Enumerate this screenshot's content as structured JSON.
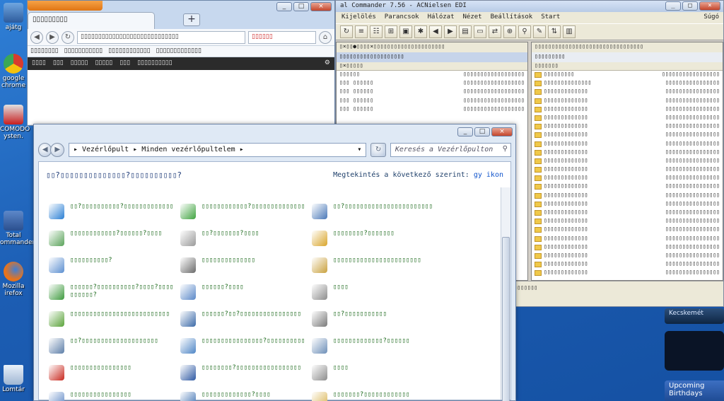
{
  "desktop": {
    "icons": [
      {
        "label": "ajátg"
      },
      {
        "label": "google chrome"
      },
      {
        "label": "COMODO ysten."
      },
      {
        "label": "Total ommander"
      },
      {
        "label": "Mozilla irefox"
      },
      {
        "label": "Lomtár"
      }
    ]
  },
  "chrome": {
    "tab_title": "▯▯▯▯▯▯▯▯▯",
    "omnibox": "▯▯▯▯▯▯▯▯▯▯▯▯▯▯▯▯▯▯▯▯▯▯▯▯▯▯▯▯",
    "search": "▯▯▯▯▯▯",
    "bookmarks": [
      "▯▯▯▯▯▯▯▯",
      "▯▯▯▯▯▯▯▯▯▯▯",
      "▯▯▯▯▯▯▯▯▯▯▯▯",
      "▯▯▯▯▯▯▯▯▯▯▯▯▯"
    ],
    "darkbar": [
      "▯▯▯▯",
      "▯▯▯",
      "▯▯▯▯▯",
      "▯▯▯▯▯",
      "▯▯▯",
      "▯▯▯▯▯▯▯▯▯▯"
    ]
  },
  "tc": {
    "title": "al Commander 7.56 - ACNielsen EDI",
    "menu": [
      "Kijelölés",
      "Parancsok",
      "Hálózat",
      "Nézet",
      "Beállítások",
      "Start"
    ],
    "help": "Súgó",
    "left_drive": "▯×▯▯●▯▯▯▯×▯▯▯▯▯▯▯▯▯▯▯▯▯▯▯▯▯▯▯▯▯",
    "left_path": "▯▯▯▯▯▯▯▯▯▯▯▯▯▯▯▯▯▯▯",
    "left_col": "▯×▯▯▯▯▯",
    "left_rows": [
      {
        "name": "▯▯▯▯▯▯",
        "size": "▯▯▯▯▯▯▯▯▯▯▯▯▯▯▯▯▯▯"
      },
      {
        "name": "▯▯▯  ▯▯▯▯▯▯",
        "size": "▯▯▯▯▯▯▯▯▯▯▯▯▯▯▯▯▯▯"
      },
      {
        "name": "▯▯▯  ▯▯▯▯▯▯",
        "size": "▯▯▯▯▯▯▯▯▯▯▯▯▯▯▯▯▯▯"
      },
      {
        "name": "▯▯▯  ▯▯▯▯▯▯",
        "size": "▯▯▯▯▯▯▯▯▯▯▯▯▯▯▯▯▯▯"
      },
      {
        "name": "▯▯▯  ▯▯▯▯▯▯",
        "size": "▯▯▯▯▯▯▯▯▯▯▯▯▯▯▯▯▯▯"
      }
    ],
    "right_drive": "▯▯▯▯▯▯▯▯▯▯▯▯▯▯▯▯▯▯▯▯▯▯▯▯▯▯▯▯▯▯▯▯",
    "right_path": "▯▯▯▯▯▯▯▯▯",
    "right_col": "▯▯▯▯▯▯▯",
    "right_rows": [
      {
        "name": "▯▯▯▯▯▯▯▯▯",
        "size": "▯▯▯▯▯▯▯▯▯▯▯▯▯▯▯▯▯"
      },
      {
        "name": "▯▯▯▯▯▯▯▯▯▯▯▯▯▯",
        "size": "▯▯▯▯▯▯▯▯▯▯▯▯▯▯▯▯"
      },
      {
        "name": "▯▯▯▯▯▯▯▯▯▯▯▯▯",
        "size": "▯▯▯▯▯▯▯▯▯▯▯▯▯▯▯▯"
      },
      {
        "name": "▯▯▯▯▯▯▯▯▯▯▯▯▯",
        "size": "▯▯▯▯▯▯▯▯▯▯▯▯▯▯▯▯"
      },
      {
        "name": "▯▯▯▯▯▯▯▯▯▯▯▯▯",
        "size": "▯▯▯▯▯▯▯▯▯▯▯▯▯▯▯▯"
      },
      {
        "name": "▯▯▯▯▯▯▯▯▯▯▯▯▯",
        "size": "▯▯▯▯▯▯▯▯▯▯▯▯▯▯▯▯"
      },
      {
        "name": "▯▯▯▯▯▯▯▯▯▯▯▯▯",
        "size": "▯▯▯▯▯▯▯▯▯▯▯▯▯▯▯▯"
      },
      {
        "name": "▯▯▯▯▯▯▯▯▯▯▯▯▯",
        "size": "▯▯▯▯▯▯▯▯▯▯▯▯▯▯▯▯"
      },
      {
        "name": "▯▯▯▯▯▯▯▯▯▯▯▯▯",
        "size": "▯▯▯▯▯▯▯▯▯▯▯▯▯▯▯▯"
      },
      {
        "name": "▯▯▯▯▯▯▯▯▯▯▯▯▯",
        "size": "▯▯▯▯▯▯▯▯▯▯▯▯▯▯▯▯"
      },
      {
        "name": "▯▯▯▯▯▯▯▯▯▯▯▯▯",
        "size": "▯▯▯▯▯▯▯▯▯▯▯▯▯▯▯▯"
      },
      {
        "name": "▯▯▯▯▯▯▯▯▯▯▯▯▯",
        "size": "▯▯▯▯▯▯▯▯▯▯▯▯▯▯▯▯"
      },
      {
        "name": "▯▯▯▯▯▯▯▯▯▯▯▯▯",
        "size": "▯▯▯▯▯▯▯▯▯▯▯▯▯▯▯▯"
      },
      {
        "name": "▯▯▯▯▯▯▯▯▯▯▯▯▯",
        "size": "▯▯▯▯▯▯▯▯▯▯▯▯▯▯▯▯"
      },
      {
        "name": "▯▯▯▯▯▯▯▯▯▯▯▯▯",
        "size": "▯▯▯▯▯▯▯▯▯▯▯▯▯▯▯▯"
      },
      {
        "name": "▯▯▯▯▯▯▯▯▯▯▯▯▯",
        "size": "▯▯▯▯▯▯▯▯▯▯▯▯▯▯▯▯"
      },
      {
        "name": "▯▯▯▯▯▯▯▯▯▯▯▯▯",
        "size": "▯▯▯▯▯▯▯▯▯▯▯▯▯▯▯▯"
      },
      {
        "name": "▯▯▯▯▯▯▯▯▯▯▯▯▯",
        "size": "▯▯▯▯▯▯▯▯▯▯▯▯▯▯▯▯"
      },
      {
        "name": "▯▯▯▯▯▯▯▯▯▯▯▯▯",
        "size": "▯▯▯▯▯▯▯▯▯▯▯▯▯▯▯▯"
      },
      {
        "name": "▯▯▯▯▯▯▯▯▯▯▯▯▯",
        "size": "▯▯▯▯▯▯▯▯▯▯▯▯▯▯▯▯"
      },
      {
        "name": "▯▯▯▯▯▯▯▯▯▯▯▯▯",
        "size": "▯▯▯▯▯▯▯▯▯▯▯▯▯▯▯▯"
      },
      {
        "name": "▯▯▯▯▯▯▯▯▯▯▯▯▯",
        "size": "▯▯▯▯▯▯▯▯▯▯▯▯▯▯▯▯"
      },
      {
        "name": "▯▯▯▯▯▯▯▯▯▯▯▯▯",
        "size": "▯▯▯▯▯▯▯▯▯▯▯▯▯▯▯▯"
      },
      {
        "name": "▯▯▯▯▯▯▯▯▯▯▯▯▯",
        "size": "▯▯▯▯▯▯▯▯▯▯▯▯▯▯▯▯"
      }
    ],
    "footer_line1": "▯▯▯▯▯▯▯▯▯▯▯▯▯▯▯▯▯▯▯▯▯▯▯▯▯▯▯▯▯▯▯▯▯▯▯▯▯▯▯▯▯▯▯▯▯▯▯▯▯▯▯▯▯▯▯▯▯▯",
    "footer_line2": "▯▯▯▯▯▯▯▯▯▯▯▯▯▯▯▯▯▯▯▯▯▯▯▯▯▯▯▯▯▯▯▯▯▯▯▯▯▯▯"
  },
  "gadgets": {
    "weather_city": "Kecskemét",
    "birthdays": "Upcoming Birthdays"
  },
  "control_panel": {
    "address": [
      "Vezérlőpult",
      "Minden vezérlőpultelem"
    ],
    "search_placeholder": "Keresés a Vezérlőpulton",
    "heading": "▯▯?▯▯▯▯▯▯▯▯▯▯▯▯▯▯?▯▯▯▯▯▯▯▯▯▯?",
    "view_label": "Megtekintés a következő szerint:",
    "view_value": "gy ikon",
    "items": [
      {
        "label": "▯▯?▯▯▯▯▯▯▯▯▯▯?▯▯▯▯▯▯▯▯▯▯▯▯▯",
        "icon": "globe-icon",
        "color": "#2a7fd4"
      },
      {
        "label": "▯▯▯▯▯▯▯▯▯▯▯▯?▯▯▯▯▯▯▯▯▯▯▯▯▯▯",
        "icon": "windows-update-icon",
        "color": "#3fa33f"
      },
      {
        "label": "▯▯?▯▯▯▯▯▯▯▯▯▯▯▯▯▯▯▯▯▯▯▯▯▯▯",
        "icon": "monitor-icon",
        "color": "#4a78b8"
      },
      {
        "label": "▯▯▯▯▯▯▯▯▯▯▯▯?▯▯▯▯▯▯?▯▯▯▯",
        "icon": "autoplay-icon",
        "color": "#5aa35a"
      },
      {
        "label": "▯▯?▯▯▯▯▯▯▯?▯▯▯▯",
        "icon": "microphone-icon",
        "color": "#9a9a9a"
      },
      {
        "label": "▯▯▯▯▯▯▯▯?▯▯▯▯▯▯▯",
        "icon": "fonts-icon",
        "color": "#d9a62b"
      },
      {
        "label": "▯▯▯▯▯▯▯▯▯▯?",
        "icon": "document-icon",
        "color": "#5c8fd0"
      },
      {
        "label": "▯▯▯▯▯▯▯▯▯▯▯▯▯▯",
        "icon": "keyboard-icon",
        "color": "#6b6b6b"
      },
      {
        "label": "▯▯▯▯▯▯▯▯▯▯▯▯▯▯▯▯▯▯▯▯▯▯▯",
        "icon": "keys-icon",
        "color": "#c9a13e"
      },
      {
        "label": "▯▯▯▯▯▯?▯▯▯▯▯▯▯▯▯▯?▯▯▯▯?▯▯▯▯▯▯▯▯▯▯?",
        "icon": "sync-icon",
        "color": "#3e9a3e"
      },
      {
        "label": "▯▯▯▯▯▯?▯▯▯▯",
        "icon": "calendar-icon",
        "color": "#5a88c8"
      },
      {
        "label": "▯▯▯▯",
        "icon": "mouse-icon",
        "color": "#8d8d8d"
      },
      {
        "label": "▯▯▯▯▯▯▯▯▯▯▯▯▯▯▯▯▯▯▯▯▯▯▯▯▯▯",
        "icon": "programs-icon",
        "color": "#5aa33a"
      },
      {
        "label": "▯▯▯▯▯▯?▯▯?▯▯▯▯▯▯▯▯▯▯▯▯▯▯▯▯",
        "icon": "network-icon",
        "color": "#3c6aa8"
      },
      {
        "label": "▯▯?▯▯▯▯▯▯▯▯▯▯▯",
        "icon": "computer-icon",
        "color": "#7a7a7a"
      },
      {
        "label": "▯▯?▯▯▯▯▯▯▯▯▯▯▯▯▯▯▯▯▯▯▯▯",
        "icon": "printer-icon",
        "color": "#5d7ea8"
      },
      {
        "label": "▯▯▯▯▯▯▯▯▯▯▯▯▯▯▯▯?▯▯▯▯▯▯▯▯▯▯",
        "icon": "users-icon",
        "color": "#4f86c6"
      },
      {
        "label": "▯▯▯▯▯▯▯▯▯▯▯▯▯?▯▯▯▯▯▯",
        "icon": "admin-tools-icon",
        "color": "#6d8fb8"
      },
      {
        "label": "▯▯▯▯▯▯▯▯▯▯▯▯▯▯▯▯",
        "icon": "flash-icon",
        "color": "#c8281e"
      },
      {
        "label": "▯▯▯▯▯▯▯▯?▯▯▯▯▯▯▯▯▯▯▯▯▯▯▯▯▯",
        "icon": "network-center-icon",
        "color": "#2e59a3"
      },
      {
        "label": "▯▯▯▯",
        "icon": "speaker-icon",
        "color": "#8c8c8c"
      },
      {
        "label": "▯▯▯▯▯▯▯▯▯▯▯▯▯▯▯▯",
        "icon": "clock-icon",
        "color": "#5c86c4"
      },
      {
        "label": "▯▯▯▯▯▯▯▯▯▯▯▯▯?▯▯▯▯",
        "icon": "display-icon",
        "color": "#3c6fb0"
      },
      {
        "label": "▯▯▯▯▯▯▯?▯▯▯▯▯▯▯▯▯▯▯▯",
        "icon": "folder-icon",
        "color": "#d9b453"
      }
    ]
  }
}
